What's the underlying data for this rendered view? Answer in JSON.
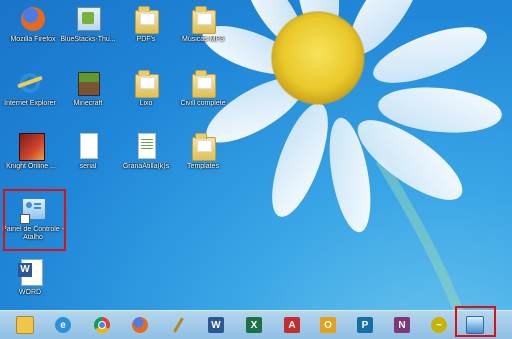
{
  "desktop": {
    "icons": [
      {
        "label": "Mozilla Firefox",
        "icon": "firefox-icon"
      },
      {
        "label": "BlueStacks-Thu...",
        "icon": "bluestacks-icon"
      },
      {
        "label": "PDF's",
        "icon": "folder-icon"
      },
      {
        "label": "Músicas MP3",
        "icon": "folder-icon"
      },
      {
        "label": "Internet Explorer",
        "icon": "internet-explorer-icon"
      },
      {
        "label": "Minecraft",
        "icon": "minecraft-icon"
      },
      {
        "label": "Lixo",
        "icon": "folder-icon"
      },
      {
        "label": "Civill complete",
        "icon": "folder-icon"
      },
      {
        "label": "Knight Online ...",
        "icon": "knight-online-icon"
      },
      {
        "label": "serial",
        "icon": "text-file-icon"
      },
      {
        "label": "GranaAtilla(k)s",
        "icon": "spreadsheet-file-icon"
      },
      {
        "label": "Templates",
        "icon": "folder-icon"
      },
      {
        "label": "Painel de Controle - Atalho",
        "icon": "control-panel-shortcut-icon"
      },
      {
        "label": "WORD",
        "icon": "word-shortcut-icon"
      }
    ]
  },
  "taskbar": {
    "items": [
      {
        "icon": "file-explorer-icon",
        "color": "#f0c64a"
      },
      {
        "icon": "internet-explorer-icon",
        "color": "#2a8fdc"
      },
      {
        "icon": "chrome-icon",
        "color": "#3aa852"
      },
      {
        "icon": "firefox-icon",
        "color": "#e66a1b"
      },
      {
        "icon": "broom-tool-icon",
        "color": "#8fbfe3"
      },
      {
        "icon": "word-icon",
        "color": "#2b5797"
      },
      {
        "icon": "excel-icon",
        "color": "#1e7145"
      },
      {
        "icon": "acrobat-icon",
        "color": "#c42d2d"
      },
      {
        "icon": "outlook-icon",
        "color": "#e3a21a"
      },
      {
        "icon": "publisher-icon",
        "color": "#1570a6"
      },
      {
        "icon": "onenote-icon",
        "color": "#7e3878"
      },
      {
        "icon": "winamp-icon",
        "color": "#c8b400"
      },
      {
        "icon": "control-panel-icon",
        "color": "#3f8ed0"
      }
    ]
  }
}
